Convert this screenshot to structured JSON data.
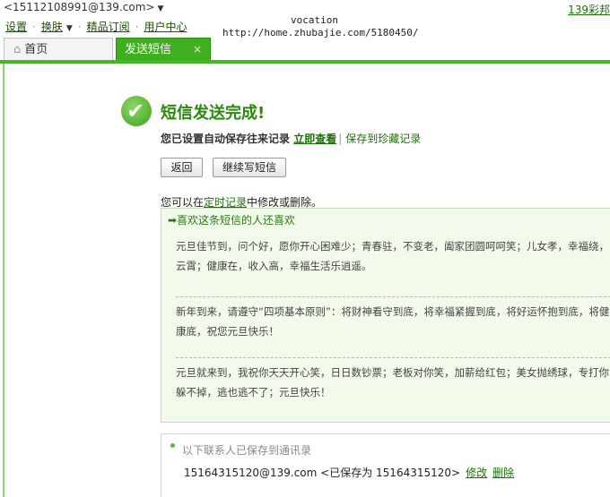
{
  "header": {
    "account": "<15112108991@139.com>",
    "corner_link": "139彩邦"
  },
  "topnav": {
    "settings": "设置",
    "skin": "换肤",
    "featured": "精品订阅",
    "user_center": "用户中心"
  },
  "watermark": {
    "line1": "vocation",
    "line2": "http://home.zhubajie.com/5180450/"
  },
  "tabs": {
    "home": "首页",
    "send_sms": "发送短信",
    "close": "×"
  },
  "result": {
    "title": "短信发送完成!",
    "autosave_text": "您已设置自动保存往来记录",
    "view_now": "立即查看",
    "save_to_favorites": "保存到珍藏记录",
    "back_button": "返回",
    "continue_button": "继续写短信",
    "timer_prefix": "您可以在",
    "timer_link": "定时记录",
    "timer_suffix": "中修改或删除。"
  },
  "recommend": {
    "heading": "➡喜欢这条短信的人还喜欢",
    "messages": [
      "元旦佳节到，问个好，愿你开心困难少；青春驻，不变老，阖家团圆呵呵笑；儿女孝，幸福绕，云霄；健康在，收入高，幸福生活乐逍遥。",
      "新年到来，请遵守“四项基本原则”：将财神看守到底，将幸福紧握到底，将好运怀抱到底，将健康底，祝您元旦快乐！",
      "元旦就来到，我祝你天天开心笑，日日数钞票；老板对你笑，加薪给红包；美女抛绣球，专打你躲不掉，逃也逃不了；元旦快乐！"
    ]
  },
  "contacts": {
    "title": "以下联系人已保存到通讯录",
    "email": "15164315120@139.com",
    "saved_as": "<已保存为 15164315120>",
    "edit": "修改",
    "delete": "删除"
  }
}
